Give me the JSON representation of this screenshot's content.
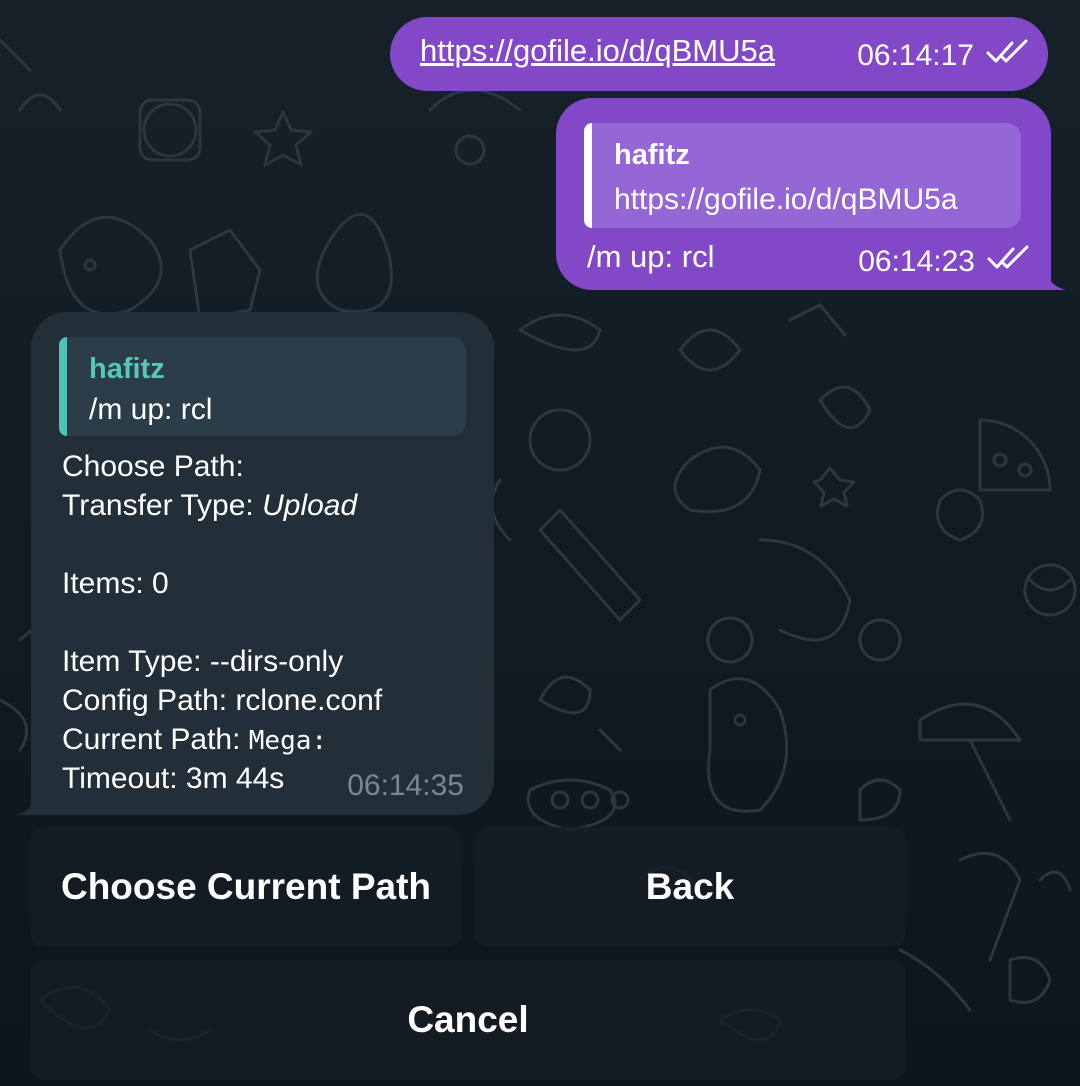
{
  "theme": {
    "outgoing_bubble": "#8348c7",
    "outgoing_reply_bg": "#9466d6",
    "incoming_bubble": "#222e38",
    "incoming_reply_bg": "#2b3d49",
    "incoming_reply_accent": "#4fc3b9",
    "background": "#111b23"
  },
  "messages": {
    "out1": {
      "link": "https://gofile.io/d/qBMU5a",
      "time": "06:14:17",
      "status_icon": "double-check-icon"
    },
    "out2": {
      "reply_name": "hafitz",
      "reply_text": "https://gofile.io/d/qBMU5a",
      "text": "/m up: rcl",
      "time": "06:14:23",
      "status_icon": "double-check-icon"
    },
    "in1": {
      "reply_name": "hafitz",
      "reply_text": "/m up: rcl",
      "choose_path": "Choose Path:",
      "transfer_type_label": "Transfer Type:",
      "transfer_type_value": "Upload",
      "items": "Items: 0",
      "item_type": "Item Type: --dirs-only",
      "config_path": "Config Path: rclone.conf",
      "current_path_label": "Current Path:",
      "current_path_value": "Mega",
      "current_path_suffix": ":",
      "timeout": "Timeout: 3m 44s",
      "time": "06:14:35"
    }
  },
  "keyboard": {
    "choose_current_path": "Choose Current Path",
    "back": "Back",
    "cancel": "Cancel"
  }
}
